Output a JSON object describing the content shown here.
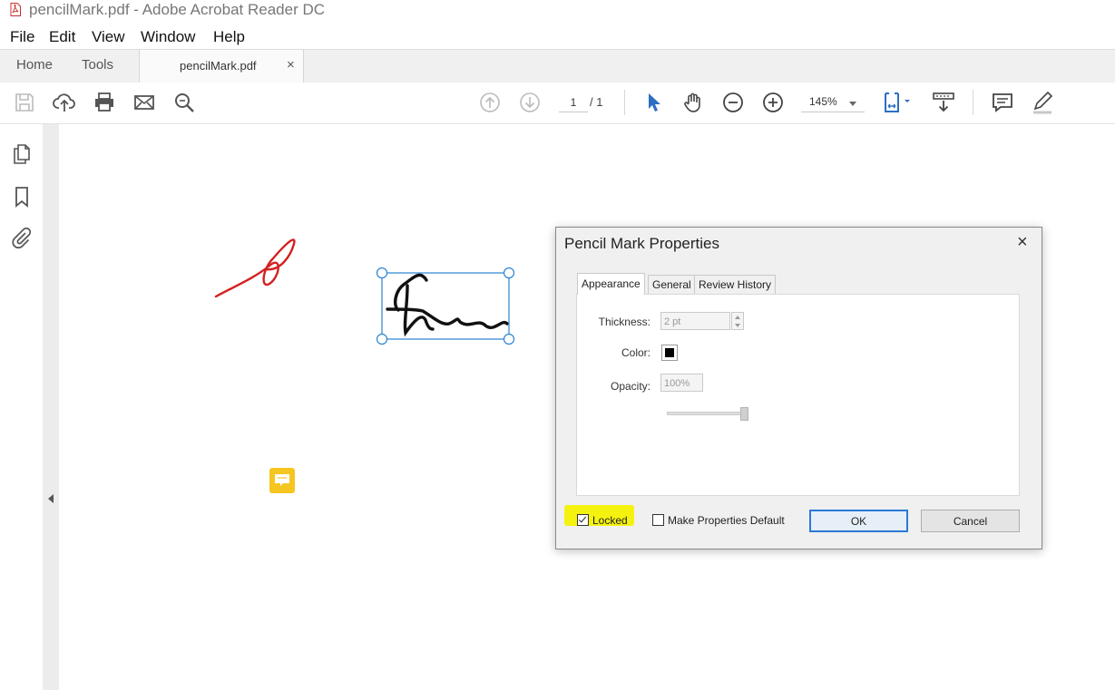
{
  "window": {
    "title": "pencilMark.pdf - Adobe Acrobat Reader DC"
  },
  "menu": {
    "items": [
      "File",
      "Edit",
      "View",
      "Window",
      "Help"
    ]
  },
  "tabs": {
    "home": "Home",
    "tools": "Tools",
    "document": "pencilMark.pdf",
    "close_glyph": "×"
  },
  "toolbar": {
    "current_page": "1",
    "page_total": "/ 1",
    "zoom": "145%",
    "icons": [
      "save-icon",
      "upload-icon",
      "print-icon",
      "email-icon",
      "search-zoom-icon",
      "prev-page-icon",
      "next-page-icon",
      "select-pointer-icon",
      "hand-icon",
      "zoom-out-icon",
      "zoom-in-icon",
      "fit-page-icon",
      "scroll-mode-icon",
      "comment-icon",
      "highlight-pen-icon"
    ],
    "accent_color": "#2c6fc2"
  },
  "left_rail": {
    "icons": [
      "pages-icon",
      "bookmark-icon",
      "attachment-icon"
    ]
  },
  "document": {
    "annotations": [
      {
        "type": "pencil-mark",
        "color": "#d42020"
      },
      {
        "type": "pencil-mark",
        "color": "#111111",
        "selected": true
      },
      {
        "type": "sticky-note",
        "color": "#f6c620"
      }
    ]
  },
  "dialog": {
    "title": "Pencil Mark Properties",
    "close_glyph": "×",
    "tabs": [
      "Appearance",
      "General",
      "Review History"
    ],
    "active_tab": "Appearance",
    "fields": {
      "thickness_label": "Thickness:",
      "thickness_value": "2 pt",
      "color_label": "Color:",
      "color_value": "#000000",
      "opacity_label": "Opacity:",
      "opacity_value": "100%",
      "opacity_slider_value": 1.0
    },
    "locked_label": "Locked",
    "locked_checked": true,
    "make_default_label": "Make Properties Default",
    "make_default_checked": false,
    "ok_label": "OK",
    "cancel_label": "Cancel",
    "highlight_color": "#f5f20f"
  }
}
